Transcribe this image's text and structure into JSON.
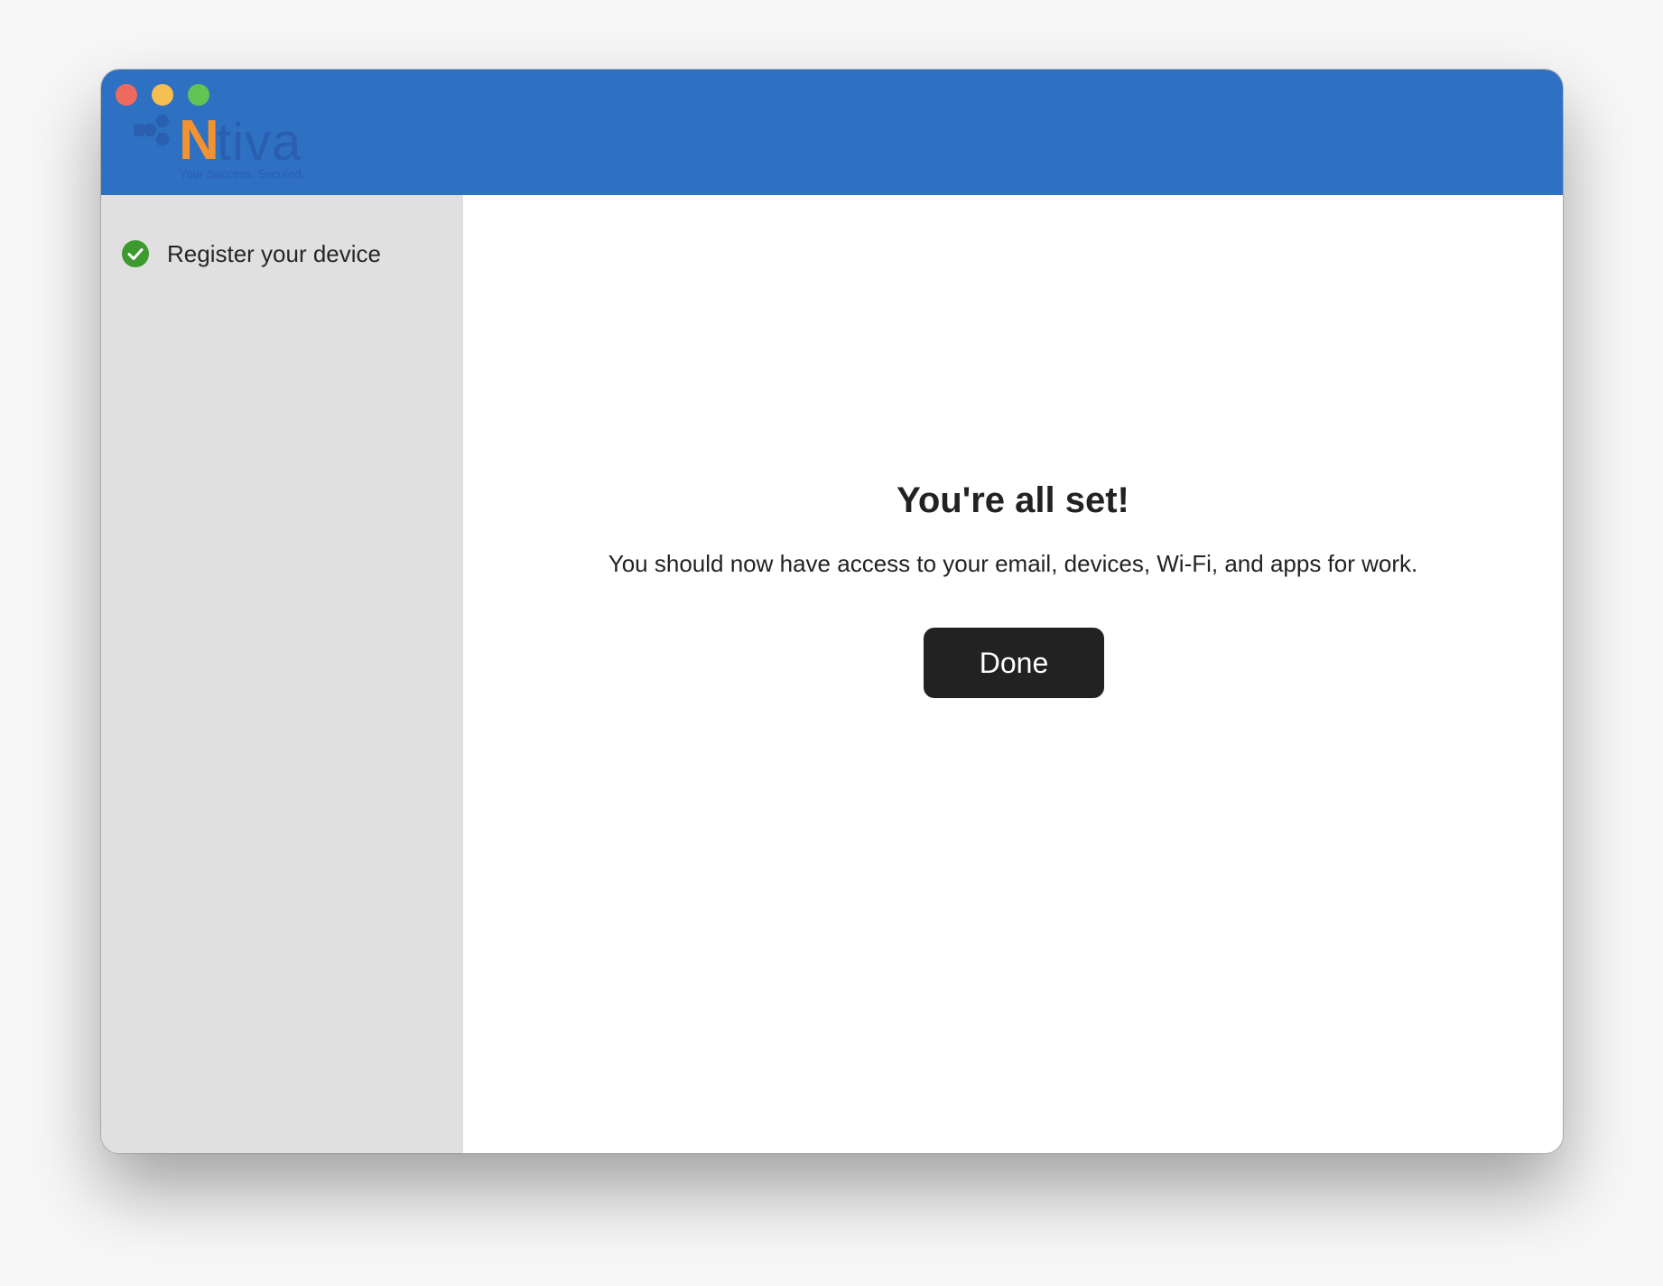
{
  "window": {
    "controls": [
      "close",
      "minimize",
      "zoom"
    ]
  },
  "header": {
    "logo": {
      "brand_initial": "N",
      "brand_rest": "tiva",
      "tagline": "Your Success. Secured.",
      "initial_color": "#f39231",
      "text_color": "#2a5fb0"
    },
    "background_color": "#2e70c2"
  },
  "sidebar": {
    "steps": [
      {
        "label": "Register your device",
        "status": "complete",
        "icon": "checkmark-circle-icon"
      }
    ]
  },
  "main": {
    "title": "You're all set!",
    "message": "You should now have access to your email, devices, Wi-Fi, and apps for work.",
    "done_label": "Done"
  }
}
